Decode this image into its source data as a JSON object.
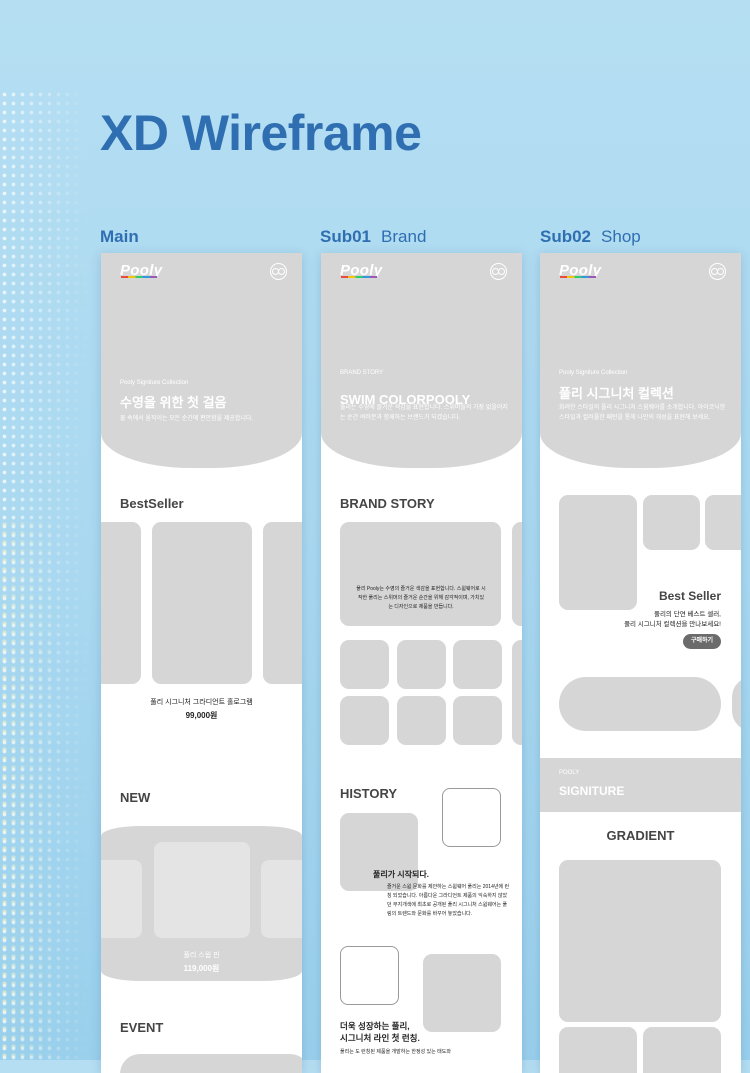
{
  "title": "XD Wireframe",
  "columns": [
    {
      "bold": "Main",
      "sub": ""
    },
    {
      "bold": "Sub01",
      "sub": "Brand"
    },
    {
      "bold": "Sub02",
      "sub": "Shop"
    }
  ],
  "logo_text": "Pooly",
  "main": {
    "hero_small": "Pooly Signiture Collection",
    "hero_title": "수영을 위한 첫 걸음",
    "hero_desc": "물 속에서 움직이는 모든 순간에 편안함을 제공합니다.",
    "bestseller_title": "BestSeller",
    "product_name": "풀리 시그니처 그라디언트 홀로그램",
    "product_price": "99,000원",
    "new_title": "NEW",
    "new_name": "풀리 스웜 핀",
    "new_price": "119,000원",
    "event_title": "EVENT"
  },
  "brand": {
    "hero_small": "BRAND STORY",
    "hero_title": "SWIM COLORPOOLY",
    "hero_desc": "풀리는 수영에 즐거운 색감을 표현합니다. 스위머들의 가장 없을어지는 순간 여러분과 함께하는 브랜드가 되겠습니다.",
    "story_title": "BRAND STORY",
    "story_text": "풀리 Pooly는 수영의 즐거운 색감을 표현합니다. 스윔웨어로 시작한 풀리는 스위머의 즐거운 순간을 위해 감각적이며, 가치있는 디자인으로 제품을 만듭니다.",
    "history_title": "HISTORY",
    "history_heading": "풀리가 시작되다.",
    "history_text": "즐거운 스윔 문화를 제안하는 스윔웨어 풀리는 2014년에 런칭 되었습니다. 아름다운 그라디언트 제품의 익숙하지 않았던 무지개색에 최초로 공개된 풀리 시그니처 스윔웨어는 풀링의 트렌드와 문화를 바꾸어 놓았습니다.",
    "growth_heading_1": "더욱 성장하는 풀리,",
    "growth_heading_2": "시그니처 라인 첫 런칭.",
    "growth_text": "풀리는 도 런칭된 제품을 개발하는 한정성 있는 태도와"
  },
  "shop": {
    "hero_small": "Pooly Signiture Collection",
    "hero_title": "풀리 시그니처 컬렉션",
    "hero_desc": "화려한 스타일의 풀리 시그니처 스윔웨어를 소개합니다. 아이코닉한 스타일과 컬러풀한 패턴을 통해 나만의 개성을 표현해 보세요.",
    "best_title": "Best Seller",
    "best_desc_1": "풀리의 단연 베스트 셀러,",
    "best_desc_2": "풀리 시그니처 컬렉션을 만나보세요!",
    "buy_button": "구매하기",
    "band_small": "POOLY",
    "band_title": "SIGNITURE",
    "gradient_title": "GRADIENT"
  },
  "colors": {
    "title": "#2f6fb1",
    "placeholder": "#d6d6d6",
    "button": "#6b6b6b"
  }
}
